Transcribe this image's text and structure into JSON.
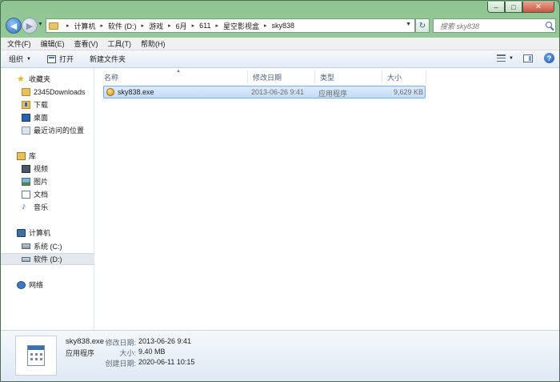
{
  "window": {
    "controls": {
      "minimize": "–",
      "maximize": "□",
      "close": "✕"
    }
  },
  "address_bar": {
    "crumbs": [
      "计算机",
      "软件 (D:)",
      "游戏",
      "6月",
      "611",
      "星空影视盒",
      "sky838"
    ],
    "separator": "▸"
  },
  "search": {
    "placeholder": "搜索 sky838"
  },
  "menu": {
    "items": [
      "文件(F)",
      "编辑(E)",
      "查看(V)",
      "工具(T)",
      "帮助(H)"
    ]
  },
  "toolbar": {
    "organize_label": "组织",
    "open_label": "打开",
    "new_folder_label": "新建文件夹",
    "help_label": "?"
  },
  "nav_pane": {
    "favorites": {
      "label": "收藏夹",
      "items": [
        "2345Downloads",
        "下载",
        "桌面",
        "最近访问的位置"
      ]
    },
    "libraries": {
      "label": "库",
      "items": [
        "视频",
        "图片",
        "文档",
        "音乐"
      ]
    },
    "computer": {
      "label": "计算机",
      "items": [
        "系统 (C:)",
        "软件 (D:)"
      ],
      "selected": "软件 (D:)"
    },
    "network": {
      "label": "网络"
    }
  },
  "file_list": {
    "columns": [
      "名称",
      "修改日期",
      "类型",
      "大小"
    ],
    "rows": [
      {
        "name": "sky838.exe",
        "modified": "2013-06-26 9:41",
        "type": "应用程序",
        "size": "9,629 KB"
      }
    ]
  },
  "details_pane": {
    "file_name": "sky838.exe",
    "file_type": "应用程序",
    "modified_label": "修改日期:",
    "modified_value": "2013-06-26 9:41",
    "size_label": "大小:",
    "size_value": "9.40 MB",
    "created_label": "创建日期:",
    "created_value": "2020-06-11 10:15"
  }
}
